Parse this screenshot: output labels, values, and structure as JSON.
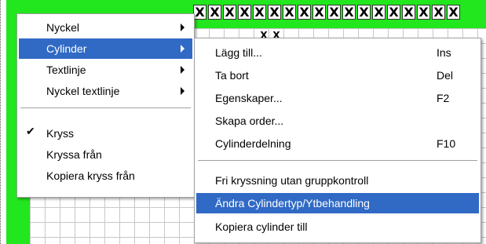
{
  "grid": {
    "header_marks": [
      "X",
      "X",
      "X",
      "X",
      "X",
      "X",
      "X",
      "X",
      "X",
      "X",
      "X",
      "X",
      "X",
      "X",
      "X",
      "X",
      "X",
      "X"
    ],
    "small_marks": [
      "X",
      "X"
    ],
    "colors": {
      "green": "#22e61e",
      "grid_line": "#c8c8c8"
    }
  },
  "main_menu": {
    "items": [
      {
        "label": "Nyckel",
        "has_submenu": true
      },
      {
        "label": "Cylinder",
        "has_submenu": true,
        "highlighted": true
      },
      {
        "label": "Textlinje",
        "has_submenu": true
      },
      {
        "label": "Nyckel textlinje",
        "has_submenu": true
      },
      {
        "label": "Kryss",
        "checked": true
      },
      {
        "label": "Kryssa från"
      },
      {
        "label": "Kopiera kryss från"
      }
    ]
  },
  "sub_menu": {
    "items": [
      {
        "label": "Lägg till...",
        "shortcut": "Ins"
      },
      {
        "label": "Ta bort",
        "shortcut": "Del"
      },
      {
        "label": "Egenskaper...",
        "shortcut": "F2"
      },
      {
        "label": "Skapa order...",
        "shortcut": ""
      },
      {
        "label": "Cylinderdelning",
        "shortcut": "F10"
      },
      {
        "label": "Fri kryssning utan gruppkontroll",
        "shortcut": ""
      },
      {
        "label": "Ändra Cylindertyp/Ytbehandling",
        "shortcut": "",
        "highlighted": true
      },
      {
        "label": "Kopiera cylinder till",
        "shortcut": ""
      }
    ]
  },
  "colors": {
    "highlight": "#316ac5",
    "highlight_text": "#ffffff"
  }
}
